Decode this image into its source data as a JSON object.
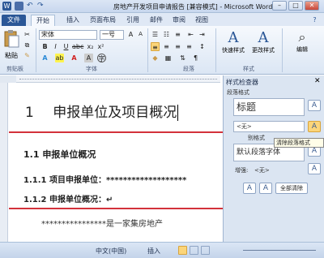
{
  "window": {
    "title": "房地产开发项目申请报告 [兼容模式] - Microsoft Word",
    "controls": [
      "–",
      "□",
      "✕"
    ]
  },
  "tabs": [
    "文件",
    "开始",
    "插入",
    "页面布局",
    "引用",
    "邮件",
    "审阅",
    "视图"
  ],
  "ribbon": {
    "paste_label": "粘贴",
    "font_name": "宋体",
    "font_size": "一号",
    "quick_styles_label": "快速样式",
    "change_styles_label": "更改样式",
    "edit_label": "编辑",
    "groups": {
      "clipboard": "剪贴板",
      "font": "字体",
      "paragraph": "段落",
      "styles": "样式"
    }
  },
  "document": {
    "heading1_num": "1",
    "heading1_text": "申报单位及项目概况",
    "h2": "1.1   申报单位概况",
    "h3a": "1.1.1 项目申报单位：*******************",
    "h3b": "1.1.2 申报单位概况：↵",
    "body": "****************是一家集房地产"
  },
  "style_inspector": {
    "title": "样式检查器",
    "para_format_label": "段落格式",
    "para_style_value": "标题",
    "para_style_modifier": "<无>",
    "char_format_label": "别格式",
    "char_style_value": "默认段落字体",
    "char_modifier_label": "增强:",
    "char_modifier_value": "<无>",
    "clear_all_label": "全部清除",
    "tooltip": "清除段落格式"
  },
  "status": {
    "lang": "中文(中国)",
    "insert": "插入"
  }
}
